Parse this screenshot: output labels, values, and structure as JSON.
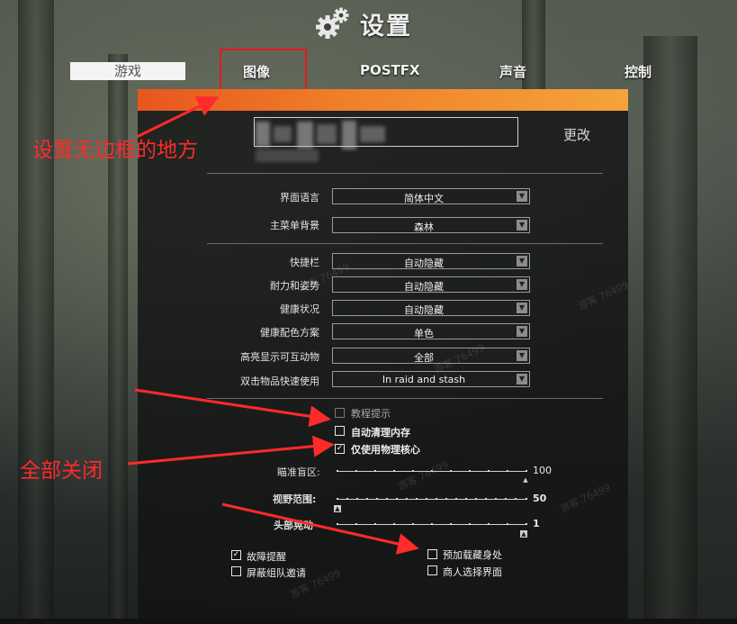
{
  "title": "设置",
  "tabs": {
    "game": "游戏",
    "image": "图像",
    "postfx": "POSTFX",
    "sound": "声音",
    "control": "控制"
  },
  "change_button": "更改",
  "dropdowns": [
    {
      "label": "界面语言",
      "value": "简体中文"
    },
    {
      "label": "主菜单背景",
      "value": "森林"
    },
    {
      "label": "快捷栏",
      "value": "自动隐藏"
    },
    {
      "label": "耐力和姿势",
      "value": "自动隐藏"
    },
    {
      "label": "健康状况",
      "value": "自动隐藏"
    },
    {
      "label": "健康配色方案",
      "value": "单色"
    },
    {
      "label": "高亮显示可互动物",
      "value": "全部"
    },
    {
      "label": "双击物品快速使用",
      "value": "In raid and stash"
    }
  ],
  "checkboxes": {
    "tutorial": {
      "label": "教程提示",
      "checked": false
    },
    "auto_clean": {
      "label": "自动清理内存",
      "checked": false
    },
    "physical_cores": {
      "label": "仅使用物理核心",
      "checked": true
    },
    "malfunction": {
      "label": "故障提醒",
      "checked": true
    },
    "block_invites": {
      "label": "屏蔽组队邀请",
      "checked": false
    },
    "preload_hideout": {
      "label": "预加载藏身处",
      "checked": false
    },
    "trader_screen": {
      "label": "商人选择界面",
      "checked": false
    }
  },
  "sliders": {
    "aim_deadzone": {
      "label": "瞄准盲区:",
      "value": "100",
      "fraction": 1.0
    },
    "fov": {
      "label": "视野范围:",
      "value": "50",
      "fraction": 0.0
    },
    "head_bob": {
      "label": "头部晃动",
      "value": "1",
      "fraction": 1.0
    }
  },
  "annotations": {
    "borderless": "设置无边框的地方",
    "all_off": "全部关闭"
  },
  "watermark": "游客 76499",
  "colors": {
    "accent_orange": "#f0822a",
    "annotation_red": "#ff2a2a"
  },
  "icons": {
    "title_icon": "gears-icon",
    "dropdown_arrow": "chevron-down-icon",
    "checkbox_check": "check-icon"
  }
}
